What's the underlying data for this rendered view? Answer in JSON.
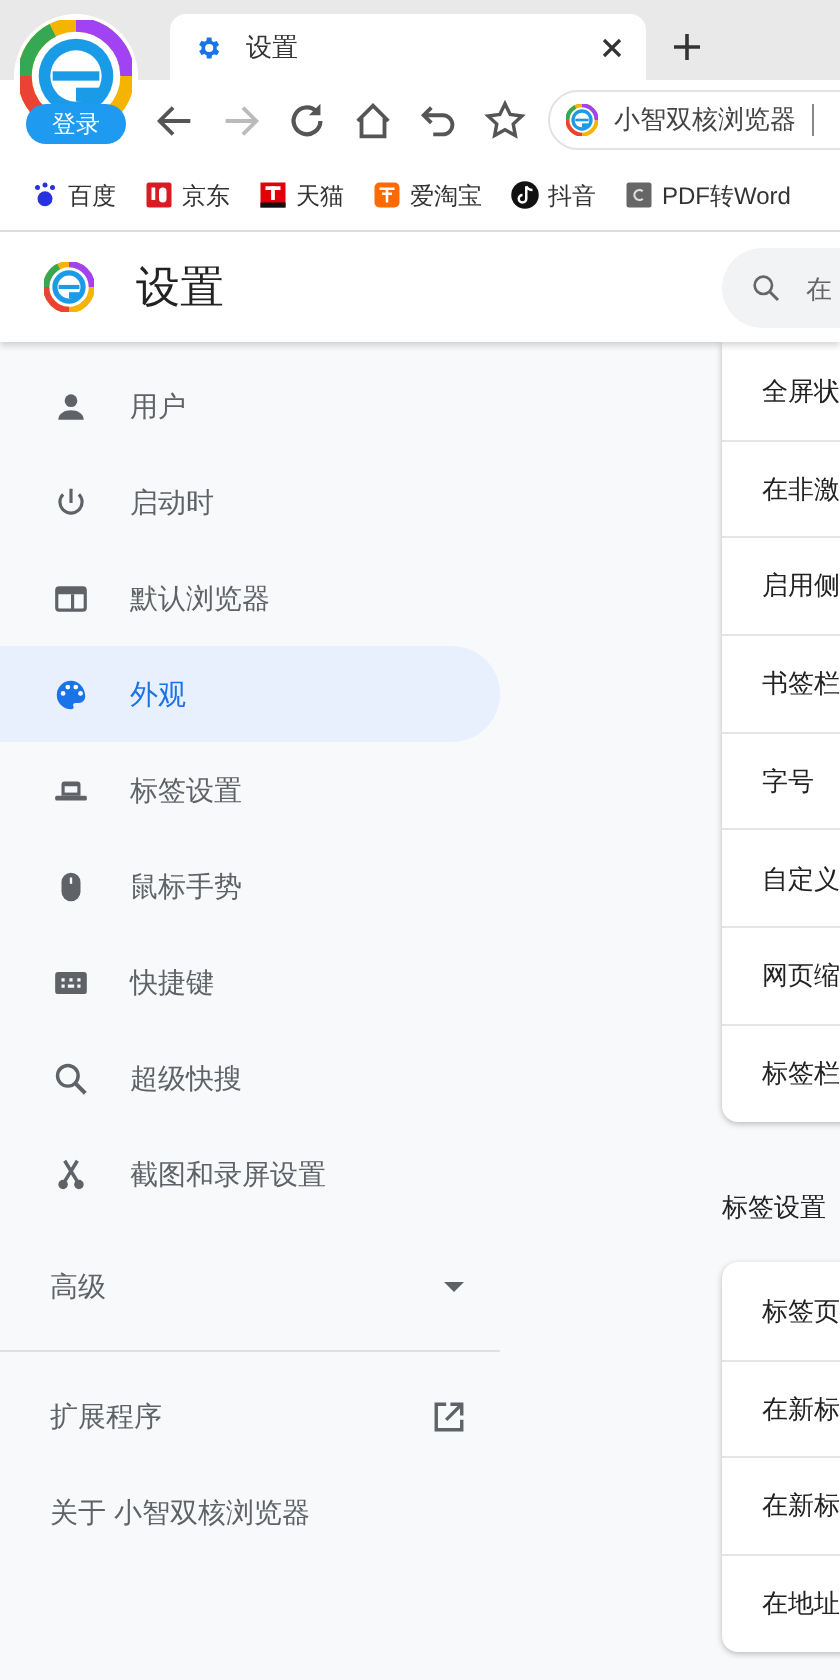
{
  "account_button": {
    "label": "登录"
  },
  "tabs": [
    {
      "title": "设置",
      "selected": true
    }
  ],
  "address_bar": {
    "text": "小智双核浏览器"
  },
  "bookmarks": [
    {
      "label": "百度",
      "kind": "paw"
    },
    {
      "label": "京东",
      "kind": "red"
    },
    {
      "label": "天猫",
      "kind": "tee"
    },
    {
      "label": "爱淘宝",
      "kind": "orange"
    },
    {
      "label": "抖音",
      "kind": "note"
    },
    {
      "label": "PDF转Word",
      "kind": "gray"
    }
  ],
  "header": {
    "title": "设置",
    "search_placeholder": "在"
  },
  "sidebar": {
    "items": [
      {
        "label": "用户",
        "kind": "person",
        "selected": false
      },
      {
        "label": "启动时",
        "kind": "power",
        "selected": false
      },
      {
        "label": "默认浏览器",
        "kind": "window",
        "selected": false
      },
      {
        "label": "外观",
        "kind": "palette",
        "selected": true
      },
      {
        "label": "标签设置",
        "kind": "tab",
        "selected": false
      },
      {
        "label": "鼠标手势",
        "kind": "mouse",
        "selected": false
      },
      {
        "label": "快捷键",
        "kind": "keyboard",
        "selected": false
      },
      {
        "label": "超级快搜",
        "kind": "search",
        "selected": false
      },
      {
        "label": "截图和录屏设置",
        "kind": "scissors",
        "selected": false
      }
    ],
    "advanced": {
      "label": "高级",
      "expanded": false
    },
    "extensions": "扩展程序",
    "about": "关于 小智双核浏览器"
  },
  "content": {
    "card_1": [
      "全屏状",
      "在非激",
      "启用侧",
      "书签栏",
      "字号",
      "自定义",
      "网页缩",
      "标签栏"
    ],
    "section_title": "标签设置",
    "card_2": [
      "标签页",
      "在新标",
      "在新标",
      "在地址"
    ]
  }
}
